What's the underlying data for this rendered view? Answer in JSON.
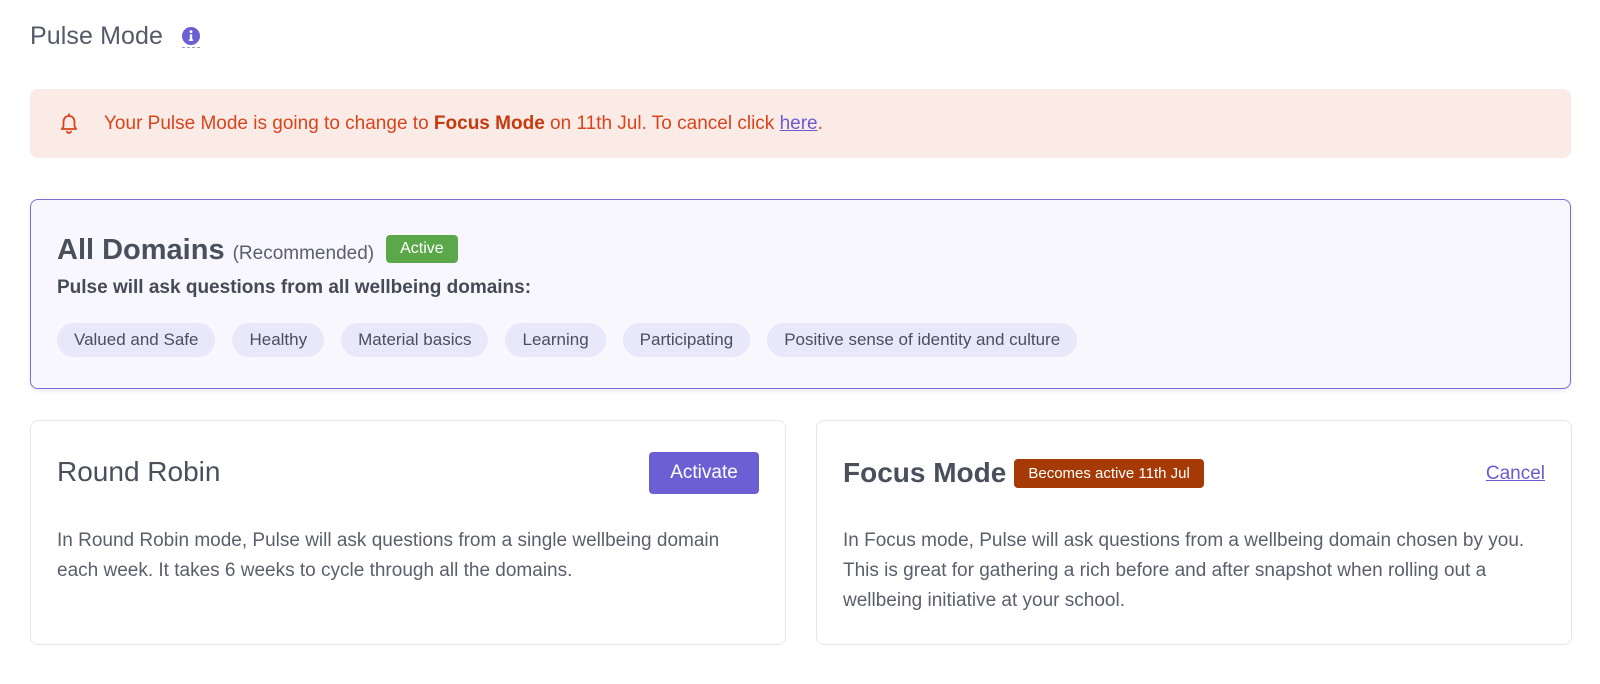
{
  "header": {
    "title": "Pulse Mode",
    "info_icon": "info-icon"
  },
  "alert": {
    "icon": "bell-icon",
    "text_before": "Your Pulse Mode is going to change to ",
    "mode_name": "Focus Mode",
    "text_middle": " on 11th Jul. To cancel click ",
    "link_label": "here",
    "text_after": "."
  },
  "all_domains": {
    "title": "All Domains",
    "recommended": "(Recommended)",
    "status_badge": "Active",
    "description": "Pulse will ask questions from all wellbeing domains:",
    "domains": [
      "Valued and Safe",
      "Healthy",
      "Material basics",
      "Learning",
      "Participating",
      "Positive sense of identity and culture"
    ]
  },
  "round_robin": {
    "title": "Round Robin",
    "button_label": "Activate",
    "description": "In Round Robin mode, Pulse will ask questions from a single wellbeing domain each week. It takes 6 weeks to cycle through all the domains."
  },
  "focus_mode": {
    "title": "Focus Mode",
    "status_badge": "Becomes active 11th Jul",
    "cancel_label": "Cancel",
    "description": "In Focus mode, Pulse will ask questions from a wellbeing domain chosen by you. This is great for gathering a rich before and after snapshot when rolling out a wellbeing initiative at your school."
  },
  "colors": {
    "accent": "#6b5fd3",
    "alert_bg": "#fbebe7",
    "alert_text": "#d8441b",
    "active_badge": "#5ba84a",
    "pending_badge": "#a53a06",
    "chip_bg": "#e9e8fa"
  }
}
